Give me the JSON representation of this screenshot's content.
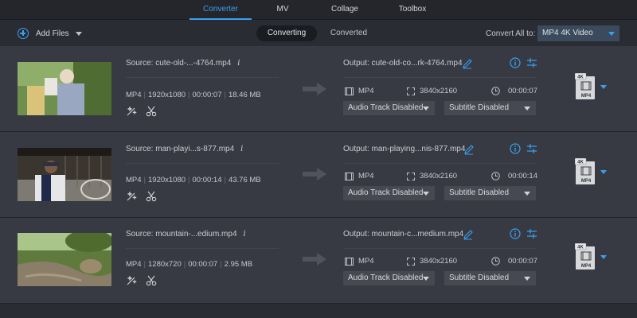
{
  "nav": {
    "tabs": [
      {
        "label": "Converter",
        "active": true
      },
      {
        "label": "MV",
        "active": false
      },
      {
        "label": "Collage",
        "active": false
      },
      {
        "label": "Toolbox",
        "active": false
      }
    ]
  },
  "toolbar": {
    "add_files_label": "Add Files",
    "segments": {
      "converting": "Converting",
      "converted": "Converted"
    },
    "convert_all_label": "Convert All to:",
    "convert_all_value": "MP4 4K Video"
  },
  "colors": {
    "accent": "#3aa0f0",
    "background": "#2a2c33",
    "row_highlight": "#373a42"
  },
  "items": [
    {
      "source": "Source: cute-old-...-4764.mp4",
      "meta": {
        "format": "MP4",
        "resolution": "1920x1080",
        "duration": "00:00:07",
        "size": "18.46 MB"
      },
      "output": "Output: cute-old-co...rk-4764.mp4",
      "out_format": "MP4",
      "out_resolution": "3840x2160",
      "out_duration": "00:00:07",
      "audio": "Audio Track Disabled",
      "subtitle": "Subtitle Disabled",
      "badge": "4K",
      "badge_format": "MP4"
    },
    {
      "source": "Source: man-playi...s-877.mp4",
      "meta": {
        "format": "MP4",
        "resolution": "1920x1080",
        "duration": "00:00:14",
        "size": "43.76 MB"
      },
      "output": "Output: man-playing...nis-877.mp4",
      "out_format": "MP4",
      "out_resolution": "3840x2160",
      "out_duration": "00:00:14",
      "audio": "Audio Track Disabled",
      "subtitle": "Subtitle Disabled",
      "badge": "4K",
      "badge_format": "MP4"
    },
    {
      "source": "Source: mountain-...edium.mp4",
      "meta": {
        "format": "MP4",
        "resolution": "1280x720",
        "duration": "00:00:07",
        "size": "2.95 MB"
      },
      "output": "Output: mountain-c...medium.mp4",
      "out_format": "MP4",
      "out_resolution": "3840x2160",
      "out_duration": "00:00:07",
      "audio": "Audio Track Disabled",
      "subtitle": "Subtitle Disabled",
      "badge": "4K",
      "badge_format": "MP4"
    }
  ]
}
